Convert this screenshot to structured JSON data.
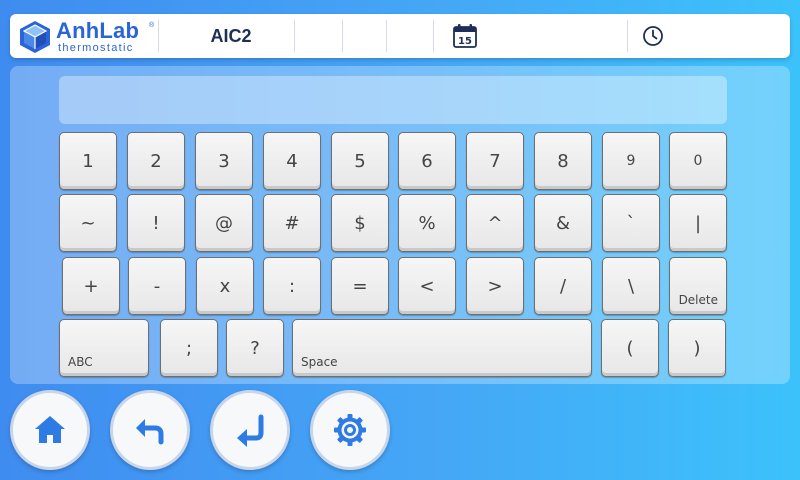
{
  "header": {
    "logo_name": "AnhLab",
    "logo_reg": "®",
    "logo_sub": "thermostatic",
    "device_name": "AIC2",
    "calendar_day": "15",
    "calendar_icon": "calendar-icon",
    "clock_icon": "clock-icon"
  },
  "input": {
    "value": ""
  },
  "keyboard": {
    "row1": [
      "1",
      "2",
      "3",
      "4",
      "5",
      "6",
      "7",
      "8",
      "9",
      "0"
    ],
    "row2": [
      "~",
      "!",
      "@",
      "#",
      "$",
      "%",
      "^",
      "&",
      "`",
      "|"
    ],
    "row3": [
      "+",
      "-",
      "x",
      ":",
      "=",
      "<",
      ">",
      "/",
      "\\",
      "Delete"
    ],
    "row4": {
      "abc": "ABC",
      "semicolon": ";",
      "question": "?",
      "space": "Space",
      "lparen": "(",
      "rparen": ")"
    }
  },
  "nav": {
    "home_icon": "home-icon",
    "back_icon": "back-icon",
    "enter_icon": "enter-icon",
    "settings_icon": "gear-icon",
    "accent": "#2e7be6"
  }
}
